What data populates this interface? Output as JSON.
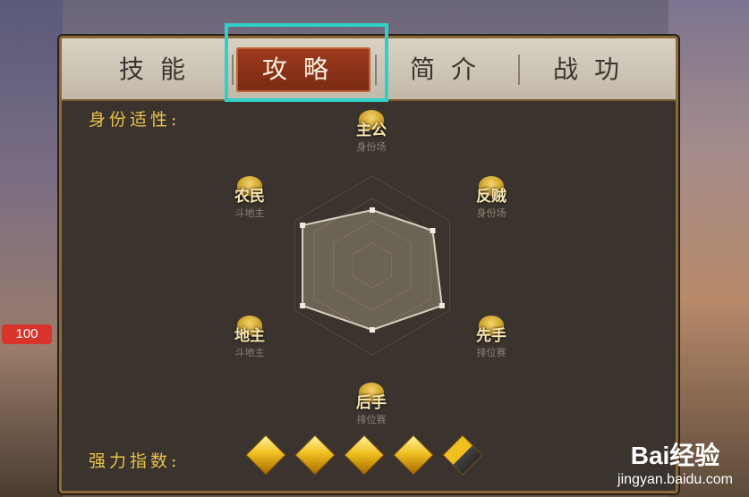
{
  "tabs": [
    {
      "label": "技能",
      "active": false
    },
    {
      "label": "攻略",
      "active": true
    },
    {
      "label": "简介",
      "active": false
    },
    {
      "label": "战功",
      "active": false
    }
  ],
  "left_badge": "100",
  "identity_label": "身份适性:",
  "roles": [
    {
      "name": "主公",
      "sub": "身份场"
    },
    {
      "name": "反贼",
      "sub": "身份场"
    },
    {
      "name": "先手",
      "sub": "排位赛"
    },
    {
      "name": "后手",
      "sub": "排位赛"
    },
    {
      "name": "地主",
      "sub": "斗地主"
    },
    {
      "name": "农民",
      "sub": "斗地主"
    }
  ],
  "radar_values": [
    0.62,
    0.78,
    0.9,
    0.72,
    0.9,
    0.9
  ],
  "strength_label": "强力指数:",
  "strength_rating": 4.5,
  "strength_max": 5,
  "watermark": {
    "top": "Bai经验",
    "bottom": "jingyan.baidu.com"
  },
  "colors": {
    "accent_highlight": "#2fd0c8",
    "gold": "#e9c24a",
    "tab_active": "#8a2f18",
    "badge": "#d9342b"
  }
}
